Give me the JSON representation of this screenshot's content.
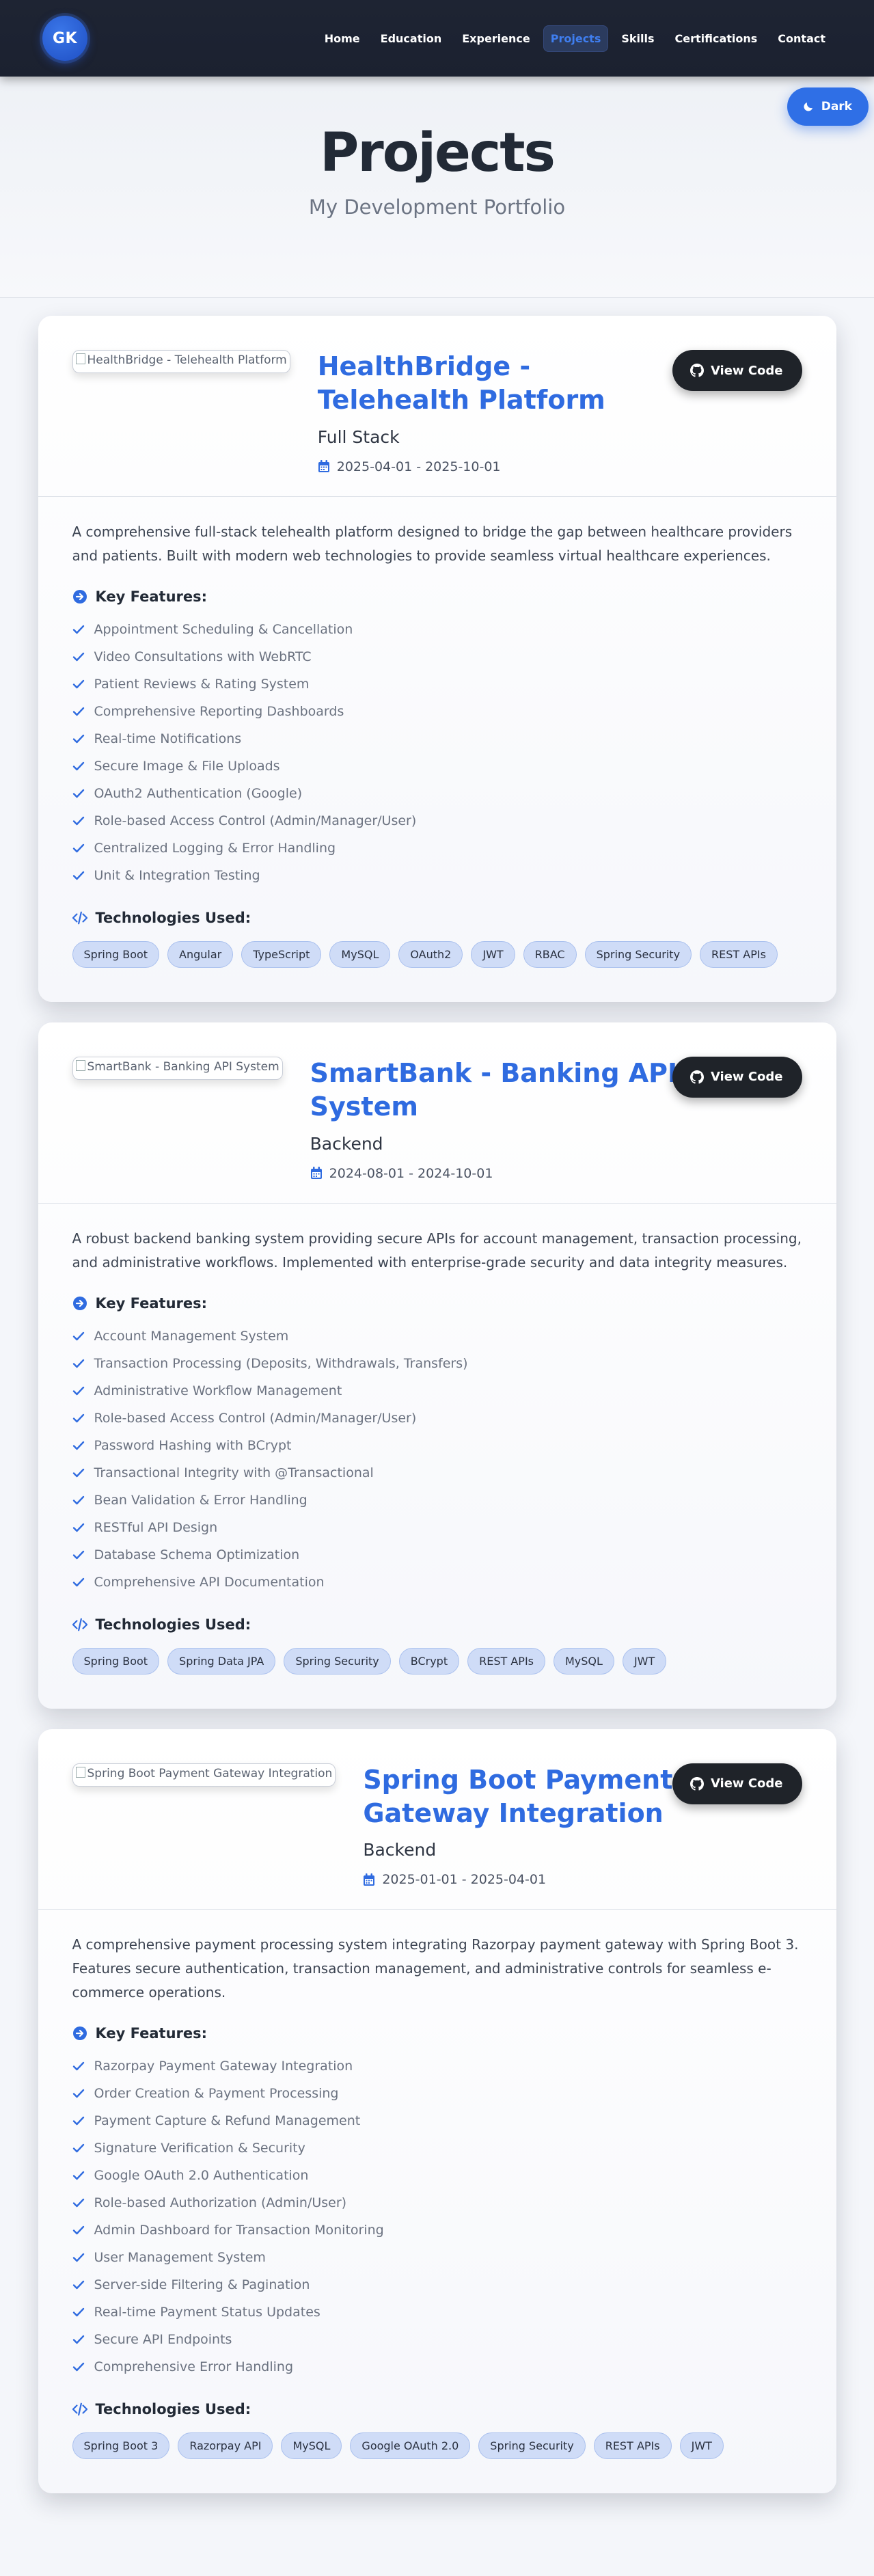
{
  "nav": {
    "logo": "GK",
    "links": [
      "Home",
      "Education",
      "Experience",
      "Projects",
      "Skills",
      "Certifications",
      "Contact"
    ],
    "active": "Projects",
    "theme_toggle": "Dark"
  },
  "hero": {
    "title": "Projects",
    "subtitle": "My Development Portfolio"
  },
  "colors": {
    "accent": "#2f6be0",
    "nav_bg": "#1e2433",
    "tag_bg": "#cfdcf7",
    "button_dark": "#1f2329"
  },
  "projects": [
    {
      "image_alt": "HealthBridge - Telehealth Platform",
      "title": "HealthBridge - Telehealth Platform",
      "type": "Full Stack",
      "dates": "2025-04-01 - 2025-10-01",
      "button": "View Code",
      "description": "A comprehensive full-stack telehealth platform designed to bridge the gap between healthcare providers and patients. Built with modern web technologies to provide seamless virtual healthcare experiences.",
      "features_heading": "Key Features:",
      "features": [
        "Appointment Scheduling & Cancellation",
        "Video Consultations with WebRTC",
        "Patient Reviews & Rating System",
        "Comprehensive Reporting Dashboards",
        "Real-time Notifications",
        "Secure Image & File Uploads",
        "OAuth2 Authentication (Google)",
        "Role-based Access Control (Admin/Manager/User)",
        "Centralized Logging & Error Handling",
        "Unit & Integration Testing"
      ],
      "tech_heading": "Technologies Used:",
      "technologies": [
        "Spring Boot",
        "Angular",
        "TypeScript",
        "MySQL",
        "OAuth2",
        "JWT",
        "RBAC",
        "Spring Security",
        "REST APIs"
      ]
    },
    {
      "image_alt": "SmartBank - Banking API System",
      "title": "SmartBank - Banking API System",
      "type": "Backend",
      "dates": "2024-08-01 - 2024-10-01",
      "button": "View Code",
      "description": "A robust backend banking system providing secure APIs for account management, transaction processing, and administrative workflows. Implemented with enterprise-grade security and data integrity measures.",
      "features_heading": "Key Features:",
      "features": [
        "Account Management System",
        "Transaction Processing (Deposits, Withdrawals, Transfers)",
        "Administrative Workflow Management",
        "Role-based Access Control (Admin/Manager/User)",
        "Password Hashing with BCrypt",
        "Transactional Integrity with @Transactional",
        "Bean Validation & Error Handling",
        "RESTful API Design",
        "Database Schema Optimization",
        "Comprehensive API Documentation"
      ],
      "tech_heading": "Technologies Used:",
      "technologies": [
        "Spring Boot",
        "Spring Data JPA",
        "Spring Security",
        "BCrypt",
        "REST APIs",
        "MySQL",
        "JWT"
      ]
    },
    {
      "image_alt": "Spring Boot Payment Gateway Integration",
      "title": "Spring Boot Payment Gateway Integration",
      "type": "Backend",
      "dates": "2025-01-01 - 2025-04-01",
      "button": "View Code",
      "description": "A comprehensive payment processing system integrating Razorpay payment gateway with Spring Boot 3. Features secure authentication, transaction management, and administrative controls for seamless e-commerce operations.",
      "features_heading": "Key Features:",
      "features": [
        "Razorpay Payment Gateway Integration",
        "Order Creation & Payment Processing",
        "Payment Capture & Refund Management",
        "Signature Verification & Security",
        "Google OAuth 2.0 Authentication",
        "Role-based Authorization (Admin/User)",
        "Admin Dashboard for Transaction Monitoring",
        "User Management System",
        "Server-side Filtering & Pagination",
        "Real-time Payment Status Updates",
        "Secure API Endpoints",
        "Comprehensive Error Handling"
      ],
      "tech_heading": "Technologies Used:",
      "technologies": [
        "Spring Boot 3",
        "Razorpay API",
        "MySQL",
        "Google OAuth 2.0",
        "Spring Security",
        "REST APIs",
        "JWT"
      ]
    }
  ]
}
